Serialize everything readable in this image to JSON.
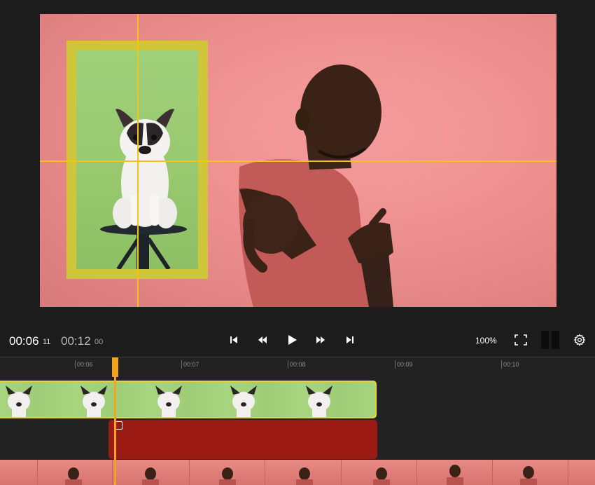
{
  "player": {
    "current_time": "00:06",
    "current_frames": "11",
    "total_time": "00:12",
    "total_frames": "00",
    "zoom": "100%",
    "icons": {
      "skip_start": "skip-to-start-icon",
      "rewind": "rewind-icon",
      "play": "play-icon",
      "fast_forward": "fast-forward-icon",
      "skip_end": "skip-to-end-icon",
      "fullscreen": "fullscreen-icon",
      "split": "split-view-icon",
      "settings": "gear-icon"
    }
  },
  "timeline": {
    "ruler_ticks": [
      "00:06",
      "00:07",
      "00:08",
      "00:09",
      "00:10"
    ],
    "colors": {
      "playhead": "#f2a51c",
      "selected_clip_border": "#e8d733",
      "effect_clip": "#9c1a14",
      "guides": "#f3c415"
    }
  }
}
